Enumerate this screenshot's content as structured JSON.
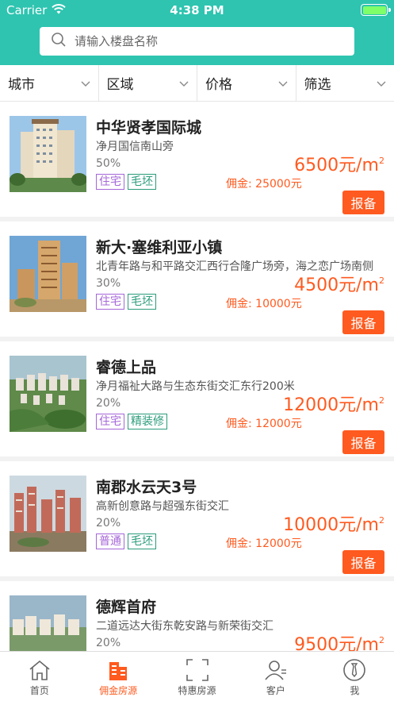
{
  "status": {
    "carrier": "Carrier",
    "time": "4:38 PM"
  },
  "search": {
    "placeholder": "请输入楼盘名称"
  },
  "filters": [
    {
      "label": "城市"
    },
    {
      "label": "区域"
    },
    {
      "label": "价格"
    },
    {
      "label": "筛选"
    }
  ],
  "listings": [
    {
      "title": "中华贤孝国际城",
      "address": "净月国信南山旁",
      "percent": "50%",
      "tags": [
        {
          "text": "住宅",
          "color": "#a566d8"
        },
        {
          "text": "毛坯",
          "color": "#2b9c7c"
        }
      ],
      "price": "6500元/m",
      "price_unit_sup": "2",
      "commission": "佣金: 25000元",
      "report_label": "报备"
    },
    {
      "title": "新大·塞维利亚小镇",
      "address": "北青年路与和平路交汇西行合隆广场旁，海之恋广场南侧",
      "percent": "30%",
      "tags": [
        {
          "text": "住宅",
          "color": "#a566d8"
        },
        {
          "text": "毛坯",
          "color": "#2b9c7c"
        }
      ],
      "price": "4500元/m",
      "price_unit_sup": "2",
      "commission": "佣金: 10000元",
      "report_label": "报备"
    },
    {
      "title": "睿德上品",
      "address": "净月福祉大路与生态东街交汇东行200米",
      "percent": "20%",
      "tags": [
        {
          "text": "住宅",
          "color": "#a566d8"
        },
        {
          "text": "精装修",
          "color": "#2b9c7c"
        }
      ],
      "price": "12000元/m",
      "price_unit_sup": "2",
      "commission": "佣金: 12000元",
      "report_label": "报备"
    },
    {
      "title": "南郡水云天3号",
      "address": "高新创意路与超强东街交汇",
      "percent": "20%",
      "tags": [
        {
          "text": "普通",
          "color": "#a566d8"
        },
        {
          "text": "毛坯",
          "color": "#2b9c7c"
        }
      ],
      "price": "10000元/m",
      "price_unit_sup": "2",
      "commission": "佣金: 12000元",
      "report_label": "报备"
    },
    {
      "title": "德辉首府",
      "address": "二道远达大街东乾安路与新荣街交汇",
      "percent": "20%",
      "tags": [],
      "price": "9500元/m",
      "price_unit_sup": "2",
      "commission": "",
      "report_label": ""
    }
  ],
  "tabbar": [
    {
      "label": "首页",
      "icon": "home-icon"
    },
    {
      "label": "佣金房源",
      "icon": "buildings-icon",
      "active": true
    },
    {
      "label": "特惠房源",
      "icon": "scan-frame-icon"
    },
    {
      "label": "客户",
      "icon": "customer-icon"
    },
    {
      "label": "我",
      "icon": "profile-tie-icon"
    }
  ],
  "colors": {
    "header": "#2ec4b0",
    "accent": "#ff5a1f",
    "tag_purple": "#a566d8",
    "tag_green": "#2b9c7c"
  }
}
